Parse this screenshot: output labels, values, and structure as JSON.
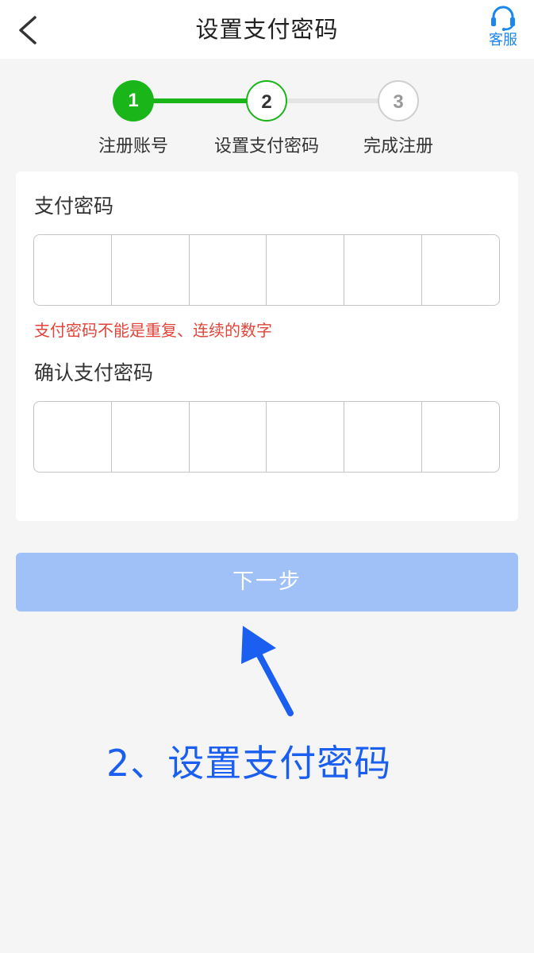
{
  "navbar": {
    "back_icon": "chevron-left-icon",
    "title": "设置支付密码",
    "service_icon": "headset-icon",
    "service_label": "客服"
  },
  "steps": [
    {
      "number": "1",
      "label": "注册账号",
      "state": "done"
    },
    {
      "number": "2",
      "label": "设置支付密码",
      "state": "current"
    },
    {
      "number": "3",
      "label": "完成注册",
      "state": "pending"
    }
  ],
  "form": {
    "password_label": "支付密码",
    "password_digits": 6,
    "error_text": "支付密码不能是重复、连续的数字",
    "confirm_label": "确认支付密码",
    "confirm_digits": 6
  },
  "next_button": {
    "label": "下一步"
  },
  "annotation": {
    "text": "2、设置支付密码"
  },
  "colors": {
    "green": "#19b519",
    "error": "#e0453a",
    "button_disabled": "#a0c1f7",
    "accent_blue": "#1a86f0",
    "annotation_blue": "#1a5ff0"
  }
}
